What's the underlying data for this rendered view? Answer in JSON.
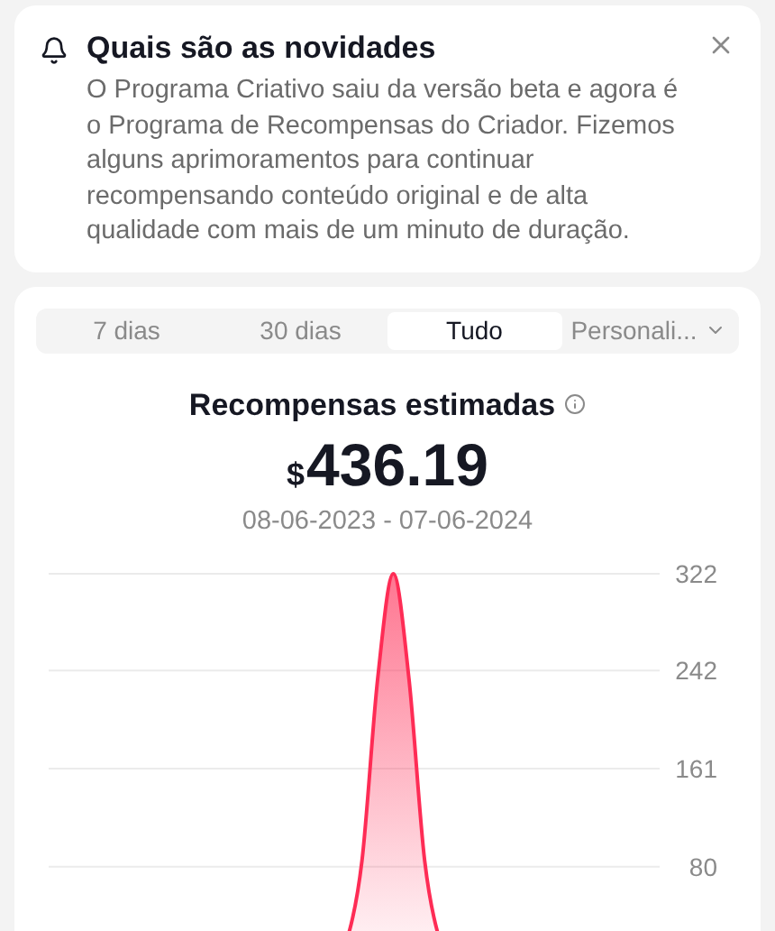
{
  "notice": {
    "title": "Quais são as novidades",
    "body": "O Programa Criativo saiu da versão beta e agora é o Programa de Recompensas do Criador. Fizemos alguns aprimoramentos para continuar recompensando conteúdo original e de alta qualidade com mais de um minuto de duração."
  },
  "tabs": [
    {
      "label": "7 dias",
      "selected": false,
      "kind": "tab"
    },
    {
      "label": "30 dias",
      "selected": false,
      "kind": "tab"
    },
    {
      "label": "Tudo",
      "selected": true,
      "kind": "tab"
    },
    {
      "label": "Personali...",
      "selected": false,
      "kind": "dropdown"
    }
  ],
  "summary": {
    "title": "Recompensas estimadas",
    "currency": "$",
    "amount": "436.19",
    "date_range": "08-06-2023 - 07-06-2024"
  },
  "chart_data": {
    "type": "area",
    "grid": true,
    "ylim": [
      0,
      322
    ],
    "yticks": [
      80,
      161,
      242,
      322
    ],
    "series": [
      {
        "color": "#fe2c55",
        "values": [
          0,
          0,
          0,
          0,
          0,
          0,
          0,
          0,
          0,
          0,
          0,
          0,
          0,
          0,
          0,
          0,
          0,
          0,
          3,
          18,
          85,
          235,
          322,
          235,
          85,
          18,
          3,
          0,
          0,
          0,
          0,
          0,
          0,
          0,
          0,
          0,
          0,
          0,
          0,
          0
        ]
      }
    ]
  }
}
